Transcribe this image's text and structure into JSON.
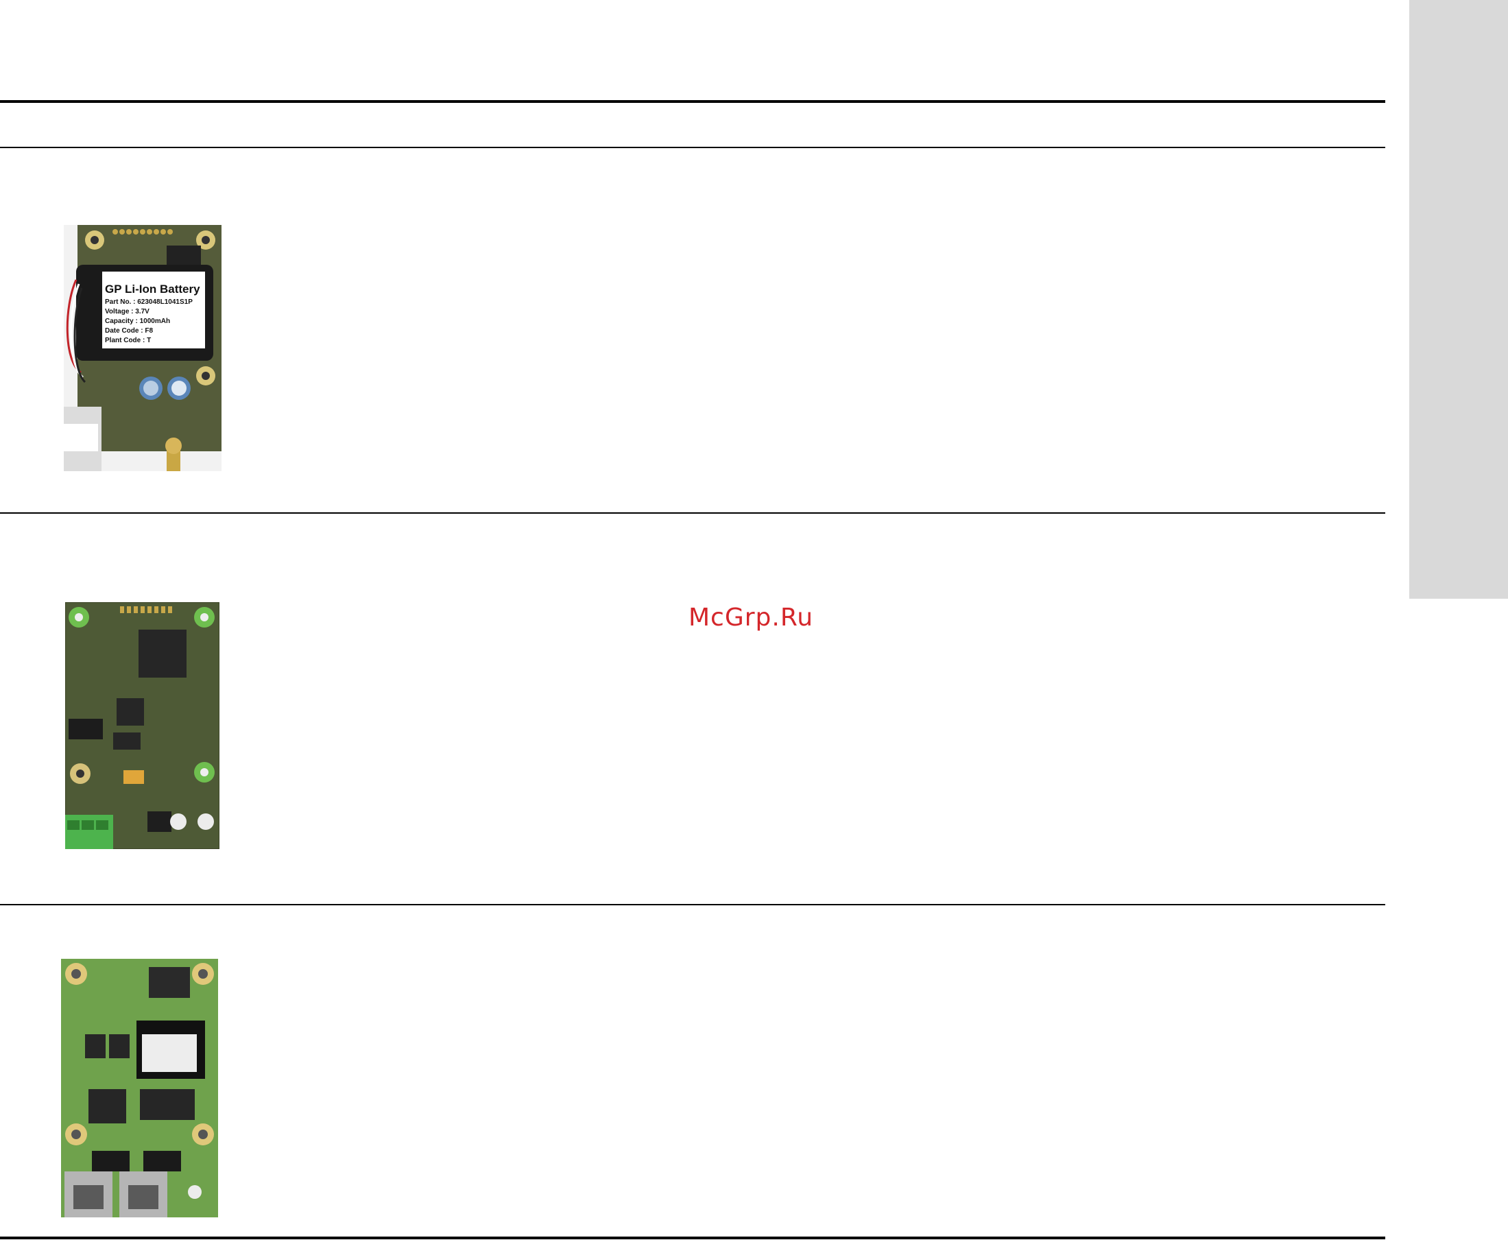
{
  "watermark": {
    "text": "McGrp.Ru"
  },
  "battery_label": {
    "title": "GP Li-Ion Battery",
    "rows": [
      {
        "key": "Part No.",
        "sep": ": ",
        "value": "623048L1041S1P"
      },
      {
        "key": "Voltage",
        "sep": ": ",
        "value": "3.7V"
      },
      {
        "key": "Capacity",
        "sep": ": ",
        "value": "1000mAh"
      },
      {
        "key": "Date Code",
        "sep": ": ",
        "value": "F8"
      },
      {
        "key": "Plant Code",
        "sep": ": ",
        "value": "T"
      }
    ]
  },
  "colors": {
    "side_tab": "#d9d9d9",
    "watermark": "#d4262a",
    "pcb_dark": "#5e6b3f",
    "pcb_green": "#6fa24c",
    "terminal_green": "#4db34d"
  }
}
